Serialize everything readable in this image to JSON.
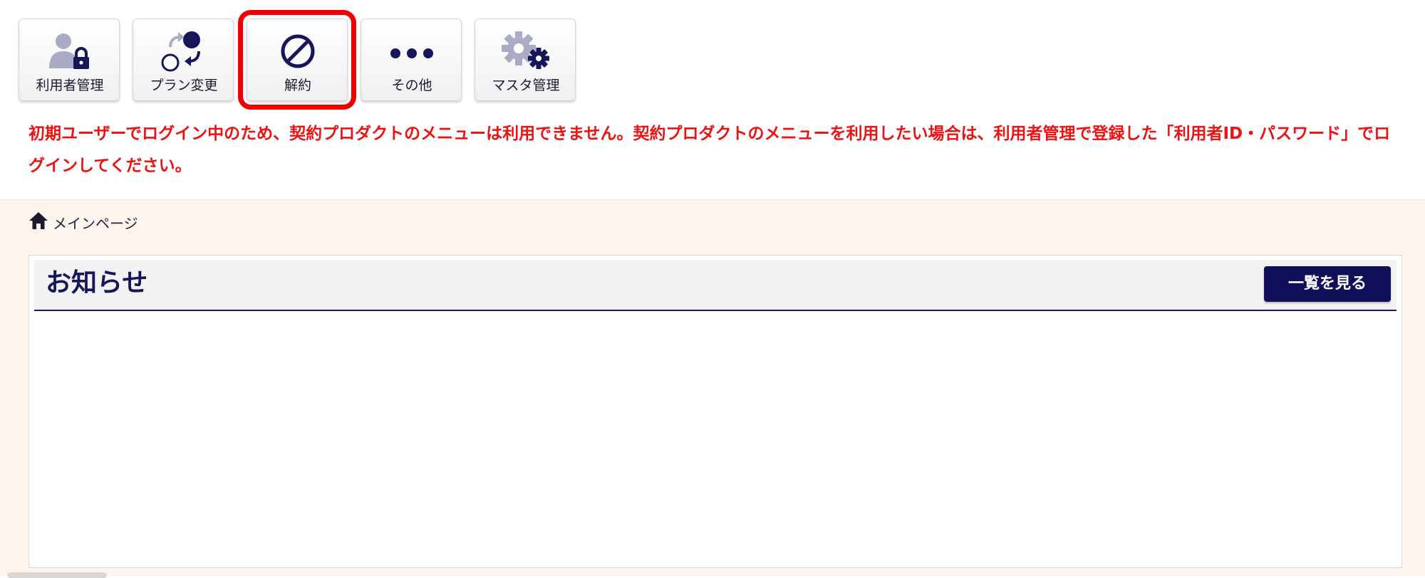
{
  "toolbar": {
    "items": [
      {
        "label": "利用者管理",
        "icon": "user-lock-icon"
      },
      {
        "label": "プラン変更",
        "icon": "plan-change-icon"
      },
      {
        "label": "解約",
        "icon": "prohibited-icon",
        "active": true
      },
      {
        "label": "その他",
        "icon": "more-dots-icon"
      },
      {
        "label": "マスタ管理",
        "icon": "gear-icon"
      }
    ]
  },
  "notice": {
    "message": "初期ユーザーでログイン中のため、契約プロダクトのメニューは利用できません。契約プロダクトのメニューを利用したい場合は、利用者管理で登録した「利用者ID・パスワード」でログインしてください。"
  },
  "breadcrumb": {
    "home_label": "メインページ",
    "icon": "home-icon"
  },
  "news": {
    "title": "お知らせ",
    "view_all_label": "一覧を見る"
  },
  "colors": {
    "accent": "#10105a",
    "icon_navy": "#16165a",
    "icon_gray": "#a9acc4",
    "warning_text": "#ee1111",
    "active_outline": "#ee0000",
    "page_background": "#fdf5ec"
  }
}
